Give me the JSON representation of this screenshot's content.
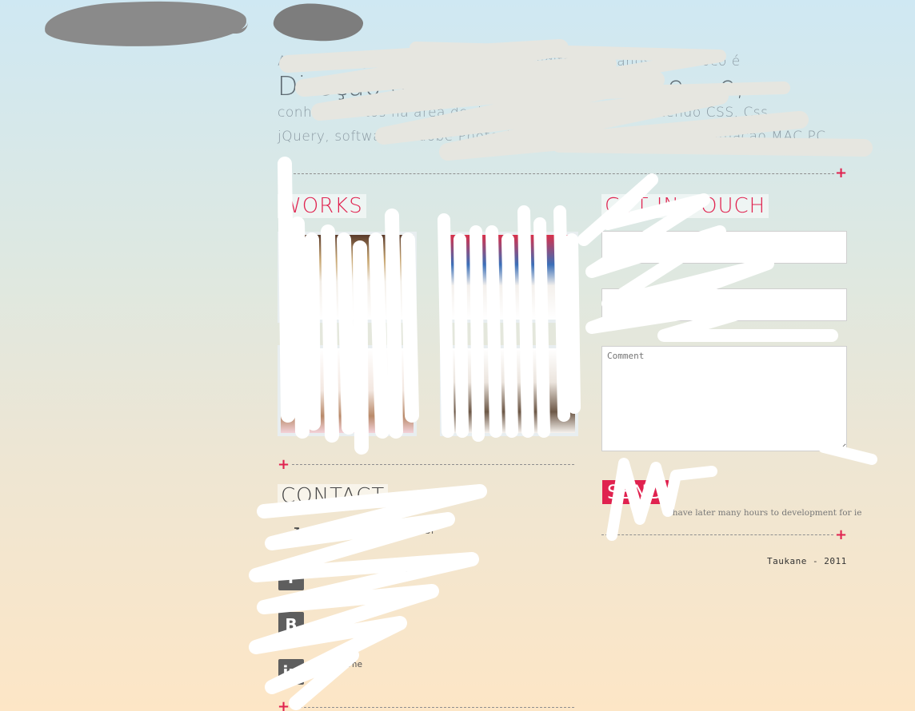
{
  "header": {
    "logo_icon": "redacted-logo",
    "nav_icon": "redacted-nav"
  },
  "intro": {
    "line1": "A ... de criação e desenvolvimento digital há 5 anos, meu foco é",
    "line2": "Direção de Arte Web Design e ...e,",
    "line3": "conhecimentos na área de desenvolvimento web contendo CSS, Css,",
    "line4": "jQuery, softwares Adobe Photoshop, Illustrator, Flash ... e animação MAC PC"
  },
  "works": {
    "heading": "WORKS",
    "items": [
      {
        "name": "work-1"
      },
      {
        "name": "work-2"
      },
      {
        "name": "work-3"
      },
      {
        "name": "work-4"
      }
    ]
  },
  "contact": {
    "heading": "CONTACT",
    "email": "contato@taukane.com.br",
    "facebook": "...ace",
    "blogger": "...ne",
    "linkedin": "...ne",
    "icons": {
      "email": "mail-arrow-icon",
      "facebook": "facebook-icon",
      "blogger": "blogger-icon",
      "linkedin": "linkedin-icon"
    }
  },
  "get_in_touch": {
    "heading": "GET IN TOUCH",
    "name_placeholder": "",
    "email_placeholder": "",
    "comment_placeholder": "Comment",
    "send_label": "SEND",
    "ie_note": "i have later many hours to development for ie"
  },
  "footer": {
    "credit": "Taukane - 2011"
  },
  "colors": {
    "accent": "#e0224f",
    "gradient_top": "#cfe8f3",
    "gradient_bottom": "#fde6c6",
    "text": "#666666"
  }
}
